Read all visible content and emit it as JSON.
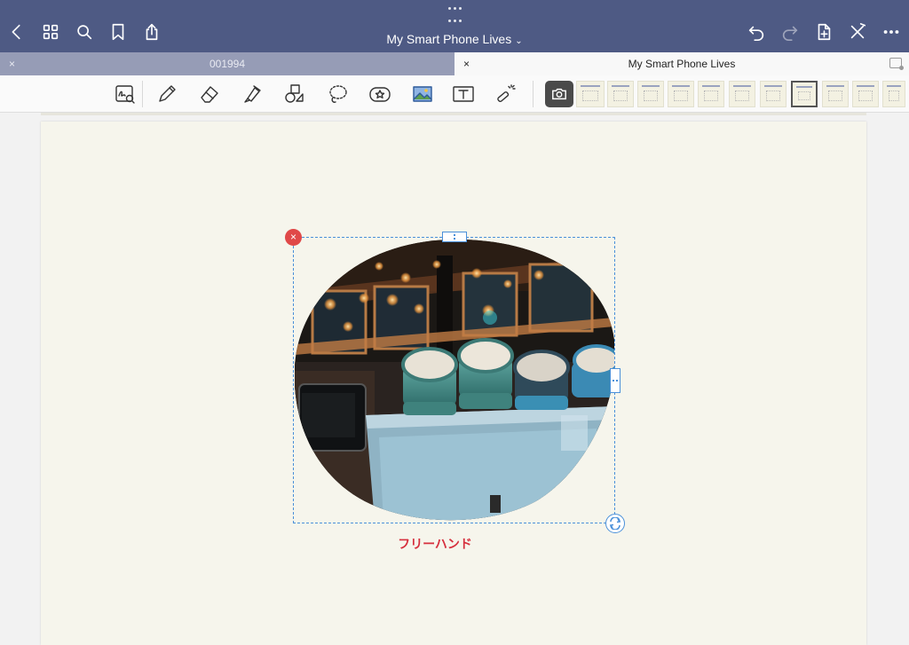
{
  "header": {
    "title": "My Smart Phone Lives",
    "title_chevron": "⌄",
    "nav_icons": [
      "back-chevron-icon",
      "grid-icon",
      "search-icon",
      "bookmark-icon",
      "share-icon"
    ],
    "right_icons": [
      "undo-icon",
      "redo-icon",
      "add-page-icon",
      "close-x-icon",
      "more-icon"
    ],
    "bar_color": "#4e5a84"
  },
  "tabs": [
    {
      "label": "001994",
      "close": "×",
      "active": false
    },
    {
      "label": "My Smart Phone Lives",
      "close": "×",
      "active": true
    }
  ],
  "toolbar": {
    "tools": [
      "zoom-window-icon",
      "pen-icon",
      "eraser-icon",
      "highlighter-icon",
      "shapes-icon",
      "lasso-icon",
      "sticker-icon",
      "image-icon",
      "text-box-icon",
      "laser-pointer-icon"
    ],
    "camera_icon": "camera-icon"
  },
  "canvas": {
    "page_color": "#f6f5ec",
    "selection": {
      "delete_glyph": "×",
      "accent_color": "#4a90d9"
    },
    "caption": "フリーハンド",
    "caption_color": "#d6303e"
  }
}
